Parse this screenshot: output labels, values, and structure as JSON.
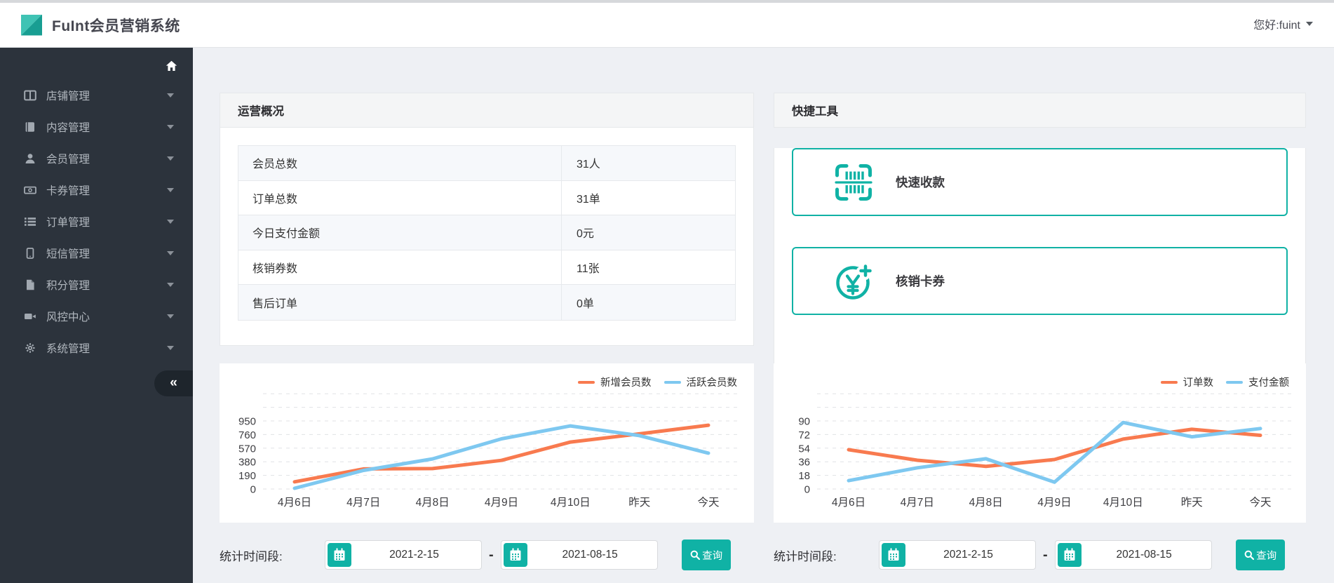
{
  "colors": {
    "accent": "#10b2a5",
    "orange": "#f87a4f",
    "blue": "#7ec8f0",
    "sidebar_bg": "#2c333c"
  },
  "header": {
    "title": "FuInt会员营销系统",
    "greeting": "您好:fuint"
  },
  "sidebar": {
    "items": [
      {
        "label": "店铺管理",
        "icon": "columns-icon"
      },
      {
        "label": "内容管理",
        "icon": "book-icon"
      },
      {
        "label": "会员管理",
        "icon": "user-icon"
      },
      {
        "label": "卡券管理",
        "icon": "money-icon"
      },
      {
        "label": "订单管理",
        "icon": "list-icon"
      },
      {
        "label": "短信管理",
        "icon": "tablet-icon"
      },
      {
        "label": "积分管理",
        "icon": "file-icon"
      },
      {
        "label": "风控中心",
        "icon": "video-icon"
      },
      {
        "label": "系统管理",
        "icon": "gear-icon"
      }
    ],
    "collapse_label": "«"
  },
  "overview": {
    "title": "运营概况",
    "rows": [
      {
        "label": "会员总数",
        "value": "31人"
      },
      {
        "label": "订单总数",
        "value": "31单"
      },
      {
        "label": "今日支付金额",
        "value": "0元"
      },
      {
        "label": "核销券数",
        "value": "11张"
      },
      {
        "label": "售后订单",
        "value": "0单"
      }
    ]
  },
  "quick_tools": {
    "title": "快捷工具",
    "tools": [
      {
        "label": "快速收款",
        "icon": "barcode-scan-icon"
      },
      {
        "label": "核销卡券",
        "icon": "yen-plus-icon"
      }
    ]
  },
  "chart_data": [
    {
      "type": "line",
      "categories": [
        "4月6日",
        "4月7日",
        "4月8日",
        "4月9日",
        "4月10日",
        "昨天",
        "今天"
      ],
      "series": [
        {
          "name": "新增会员数",
          "color": "#f87a4f",
          "values": [
            100,
            280,
            285,
            400,
            655,
            770,
            890
          ]
        },
        {
          "name": "活跃会员数",
          "color": "#7ec8f0",
          "values": [
            10,
            260,
            420,
            700,
            880,
            745,
            500
          ]
        }
      ],
      "y_ticks": [
        0,
        190,
        380,
        570,
        760,
        950
      ],
      "ylim": [
        0,
        950
      ],
      "grid": "dashed-horizontal",
      "legend_position": "top-right"
    },
    {
      "type": "line",
      "categories": [
        "4月6日",
        "4月7日",
        "4月8日",
        "4月9日",
        "4月10日",
        "昨天",
        "今天"
      ],
      "series": [
        {
          "name": "订单数",
          "color": "#f87a4f",
          "values": [
            52,
            38,
            30,
            39,
            66,
            79,
            71
          ]
        },
        {
          "name": "支付金额",
          "color": "#7ec8f0",
          "values": [
            11,
            28,
            40,
            9,
            88,
            69,
            80
          ]
        }
      ],
      "y_ticks": [
        0,
        18,
        36,
        54,
        72,
        90
      ],
      "ylim": [
        0,
        90
      ],
      "grid": "dashed-horizontal",
      "legend_position": "top-right"
    }
  ],
  "filters": [
    {
      "label": "统计时间段:",
      "start_date": "2021-2-15",
      "separator": "-",
      "end_date": "2021-08-15",
      "query_label": "查询"
    },
    {
      "label": "统计时间段:",
      "start_date": "2021-2-15",
      "separator": "-",
      "end_date": "2021-08-15",
      "query_label": "查询"
    }
  ]
}
